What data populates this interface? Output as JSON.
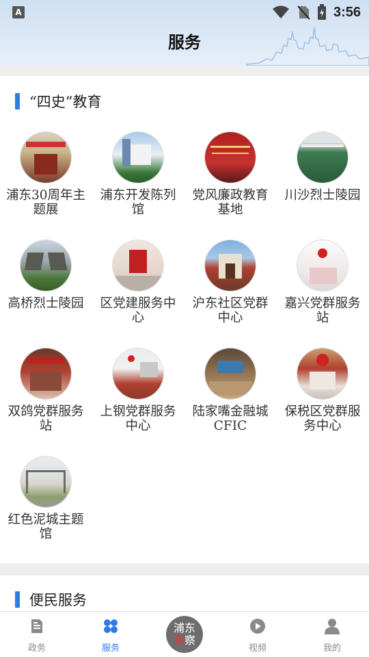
{
  "status_bar": {
    "time": "3:56",
    "left_icon_text": "A"
  },
  "header": {
    "title": "服务"
  },
  "section_history": {
    "title": "“四史”教育",
    "items": [
      {
        "label": "浦东30周年主题展",
        "icon": "exhibition-photo"
      },
      {
        "label": "浦东开发陈列馆",
        "icon": "museum-photo"
      },
      {
        "label": "党风廉政教育基地",
        "icon": "education-base-photo"
      },
      {
        "label": "川沙烈士陵园",
        "icon": "cemetery-photo"
      },
      {
        "label": "高桥烈士陵园",
        "icon": "memorial-photo"
      },
      {
        "label": "区党建服务中心",
        "icon": "service-center-photo"
      },
      {
        "label": "沪东社区党群中心",
        "icon": "community-center-photo"
      },
      {
        "label": "嘉兴党群服务站",
        "icon": "service-station-photo"
      },
      {
        "label": "双鸽党群服务站",
        "icon": "service-station-photo"
      },
      {
        "label": "上钢党群服务中心",
        "icon": "service-center-photo"
      },
      {
        "label": "陆家嘴金融城CFIC",
        "icon": "finance-city-photo"
      },
      {
        "label": "保税区党群服务中心",
        "icon": "service-center-photo"
      },
      {
        "label": "红色泥城主题馆",
        "icon": "theme-hall-photo"
      }
    ]
  },
  "section_convenience": {
    "title": "便民服务"
  },
  "bottom_nav": {
    "items": [
      {
        "label": "政务",
        "icon": "document-icon"
      },
      {
        "label": "服务",
        "icon": "grid-icon",
        "active": true
      },
      {
        "label": "视频",
        "icon": "play-icon"
      },
      {
        "label": "我的",
        "icon": "person-icon"
      }
    ],
    "center_logo_top": "浦东",
    "center_logo_bottom_red": "观",
    "center_logo_bottom": "察"
  },
  "colors": {
    "accent": "#2f7be5",
    "section_bar": "#2f7be5",
    "nav_inactive": "#888888"
  }
}
